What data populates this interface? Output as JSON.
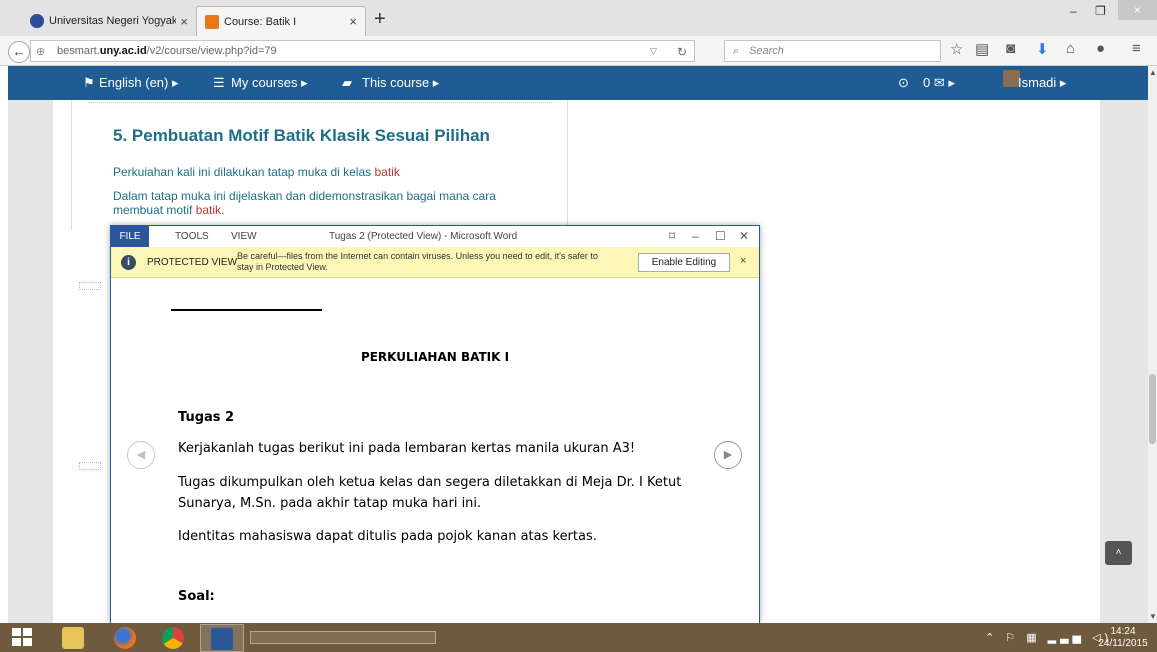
{
  "browser": {
    "tabs": [
      {
        "title": "Universitas Negeri Yogyak...",
        "close": "×"
      },
      {
        "title": "Course: Batik I",
        "close": "×"
      }
    ],
    "new_tab": "+",
    "window_controls": {
      "minimize": "–",
      "restore": "❐",
      "close": "×"
    },
    "url_prefix": "besmart.",
    "url_domain": "uny.ac.id",
    "url_path": "/v2/course/view.php?id=79",
    "search_placeholder": "Search",
    "toolbar_icons": [
      "star-icon",
      "bookmarks-icon",
      "pocket-icon",
      "download-icon",
      "home-icon",
      "chat-icon",
      "menu-icon"
    ]
  },
  "moodle": {
    "nav": {
      "language": "English (en) ▸",
      "my_courses": "My courses ▸",
      "this_course": "This course ▸",
      "messages": "0 ✉ ▸",
      "user": "Ismadi ▸"
    },
    "section": {
      "title": "5. Pembuatan Motif Batik Klasik Sesuai Pilihan",
      "p1_text": "Perkuiahan kali ini dilakukan tatap muka di kelas ",
      "p1_highlight": "batik",
      "p2_text": "Dalam tatap muka ini dijelaskan dan didemonstrasikan bagai mana cara membuat motif ",
      "p2_highlight": "batik",
      "p2_end": "."
    },
    "back_to_top": "˄"
  },
  "word": {
    "menu": {
      "file": "FILE",
      "tools": "TOOLS",
      "view": "VIEW"
    },
    "title": "Tugas 2 (Protected View) - Microsoft Word",
    "controls": {
      "mode": "⌑",
      "minimize": "–",
      "maximize": "☐",
      "close": "✕"
    },
    "protected_view": {
      "label": "PROTECTED VIEW",
      "message": "Be careful—files from the Internet can contain viruses. Unless you need to edit, it's safer to stay in Protected View.",
      "button": "Enable Editing",
      "close": "×"
    },
    "document": {
      "heading": "PERKULIAHAN BATIK I",
      "tugas": "Tugas 2",
      "p1": "Kerjakanlah tugas berikut ini pada lembaran kertas manila ukuran A3!",
      "p2": "Tugas dikumpulkan oleh ketua kelas dan segera diletakkan di Meja Dr. I Ketut Sunarya, M.Sn. pada akhir tatap muka hari ini.",
      "p3": "Identitas mahasiswa dapat ditulis pada pojok kanan atas kertas.",
      "soal": "Soal:"
    }
  },
  "taskbar": {
    "clock_time": "14:24",
    "clock_date": "24/11/2015",
    "tray": "⌃ ⚐ ▦ ▂▃▅ ◁)"
  }
}
